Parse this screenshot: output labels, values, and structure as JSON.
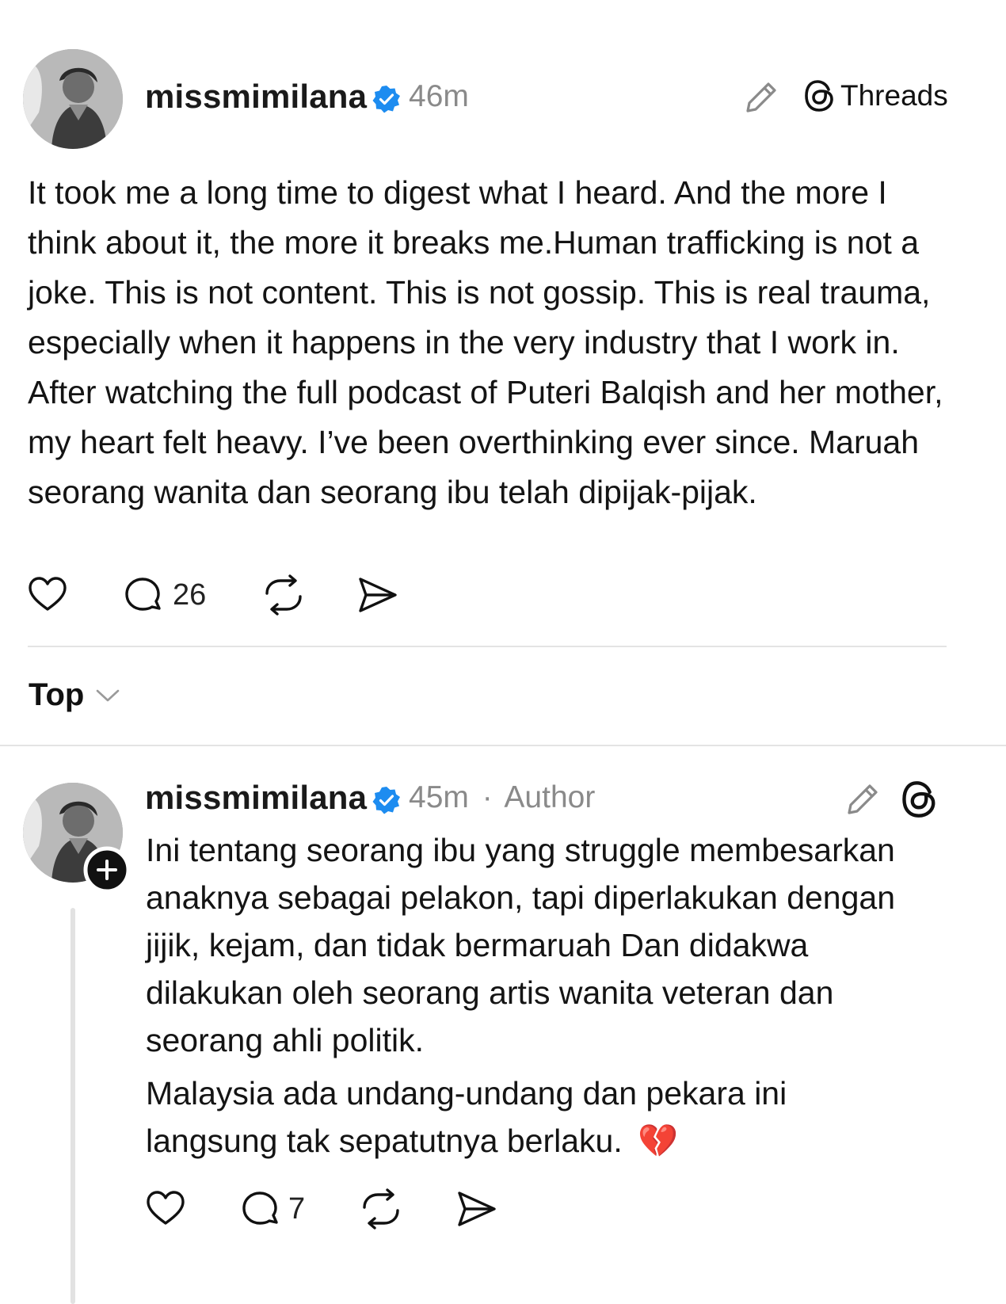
{
  "post": {
    "username": "missmimilana",
    "time": "46m",
    "app_label": "Threads",
    "text": "It took me a long time to digest what I heard. And the more I think about it, the more it breaks me.Human trafficking is not a joke. This is not content. This is not gossip. This is real trauma, especially when it happens in the very industry that I work in. After watching the full podcast of Puteri Balqish and her mother, my heart felt heavy. I’ve been overthinking ever since. Maruah seorang wanita dan seorang ibu telah dipijak-pijak.",
    "reply_count": "26"
  },
  "sort": {
    "label": "Top"
  },
  "reply": {
    "username": "missmimilana",
    "time": "45m",
    "separator": "·",
    "author_label": "Author",
    "text_part1": "Ini tentang seorang ibu yang struggle membesarkan anaknya sebagai pelakon, tapi diperlakukan dengan jijik, kejam, dan tidak bermaruah Dan didakwa dilakukan oleh seorang artis wanita veteran dan seorang ahli politik.",
    "text_part2": "Malaysia ada undang-undang dan pekara ini langsung tak sepatutnya berlaku.",
    "emoji": "💔",
    "reply_count": "7"
  },
  "colors": {
    "verified": "#1d8cf0",
    "meta_gray": "#8a8a8a",
    "divider": "#e4e4e4"
  }
}
